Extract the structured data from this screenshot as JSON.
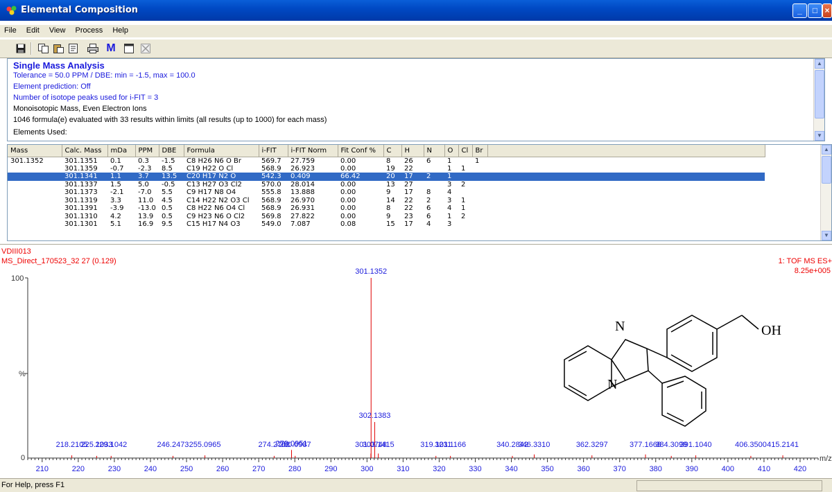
{
  "window": {
    "title": "Elemental Composition"
  },
  "menu": [
    {
      "label": "File",
      "key": "F"
    },
    {
      "label": "Edit",
      "key": "E"
    },
    {
      "label": "View",
      "key": "V"
    },
    {
      "label": "Process",
      "key": "P"
    },
    {
      "label": "Help",
      "key": "H"
    }
  ],
  "toolbar": [
    "save-icon",
    "copy-icon",
    "paste-icon",
    "properties-icon",
    "print-icon",
    "mass-icon",
    "window-icon",
    "delete-icon"
  ],
  "toolbar_mass_label": "M",
  "info": {
    "heading": "Single Mass Analysis",
    "tolerance": "Tolerance = 50.0 PPM   /   DBE: min = -1.5, max = 100.0",
    "element_prediction": "Element prediction: Off",
    "isotope_peaks": "Number of isotope peaks used for i-FIT = 3",
    "mass_mode": "Monoisotopic Mass, Even Electron Ions",
    "formulae": "1046 formula(e) evaluated with 33 results within limits (all results (up to 1000) for each mass)",
    "elements_used": "Elements Used:"
  },
  "results": {
    "columns": [
      "Mass",
      "Calc. Mass",
      "mDa",
      "PPM",
      "DBE",
      "Formula",
      "i-FIT",
      "i-FIT Norm",
      "Fit Conf %",
      "C",
      "H",
      "N",
      "O",
      "Cl",
      "Br"
    ],
    "rows": [
      [
        "301.1352",
        "301.1351",
        "0.1",
        "0.3",
        "-1.5",
        "C8  H26  N6  O  Br",
        "569.7",
        "27.759",
        "0.00",
        "8",
        "26",
        "6",
        "1",
        "",
        "1"
      ],
      [
        "",
        "301.1359",
        "-0.7",
        "-2.3",
        "8.5",
        "C19  H22  O  Cl",
        "568.9",
        "26.923",
        "0.00",
        "19",
        "22",
        "",
        "1",
        "1",
        ""
      ],
      [
        "",
        "301.1341",
        "1.1",
        "3.7",
        "13.5",
        "C20  H17  N2  O",
        "542.3",
        "0.409",
        "66.42",
        "20",
        "17",
        "2",
        "1",
        "",
        ""
      ],
      [
        "",
        "301.1337",
        "1.5",
        "5.0",
        "-0.5",
        "C13  H27  O3  Cl2",
        "570.0",
        "28.014",
        "0.00",
        "13",
        "27",
        "",
        "3",
        "2",
        ""
      ],
      [
        "",
        "301.1373",
        "-2.1",
        "-7.0",
        "5.5",
        "C9  H17  N8  O4",
        "555.8",
        "13.888",
        "0.00",
        "9",
        "17",
        "8",
        "4",
        "",
        ""
      ],
      [
        "",
        "301.1319",
        "3.3",
        "11.0",
        "4.5",
        "C14  H22  N2  O3  Cl",
        "568.9",
        "26.970",
        "0.00",
        "14",
        "22",
        "2",
        "3",
        "1",
        ""
      ],
      [
        "",
        "301.1391",
        "-3.9",
        "-13.0",
        "0.5",
        "C8  H22  N6  O4  Cl",
        "568.9",
        "26.931",
        "0.00",
        "8",
        "22",
        "6",
        "4",
        "1",
        ""
      ],
      [
        "",
        "301.1310",
        "4.2",
        "13.9",
        "0.5",
        "C9  H23  N6  O  Cl2",
        "569.8",
        "27.822",
        "0.00",
        "9",
        "23",
        "6",
        "1",
        "2",
        ""
      ],
      [
        "",
        "301.1301",
        "5.1",
        "16.9",
        "9.5",
        "C15  H17  N4  O3",
        "549.0",
        "7.087",
        "0.08",
        "15",
        "17",
        "4",
        "3",
        "",
        ""
      ]
    ],
    "selected_row": 2
  },
  "spectrum": {
    "sample": "VDIII013",
    "scan": "MS_Direct_170523_32 27 (0.129)",
    "mode": "1: TOF MS ES+",
    "intensity": "8.25e+005",
    "y_top": "100",
    "y_mid": "%",
    "y_zero": "0",
    "x_unit": "m/z",
    "molecule_label": "OH",
    "n_label": "N"
  },
  "chart_data": {
    "type": "bar",
    "xlim": [
      206,
      425
    ],
    "ylim": [
      0,
      100
    ],
    "xticks": [
      210,
      220,
      230,
      240,
      250,
      260,
      270,
      280,
      290,
      300,
      310,
      320,
      330,
      340,
      350,
      360,
      370,
      380,
      390,
      400,
      410,
      420
    ],
    "peaks": [
      {
        "mz": 218.2105,
        "rel": 1.5,
        "label": "218.2105"
      },
      {
        "mz": 225.1033,
        "rel": 1.2,
        "label": "225.1033"
      },
      {
        "mz": 229.1042,
        "rel": 1.2,
        "label": "229.1042"
      },
      {
        "mz": 246.2473,
        "rel": 1.2,
        "label": "246.2473"
      },
      {
        "mz": 255.0965,
        "rel": 1.5,
        "label": "255.0965"
      },
      {
        "mz": 274.2762,
        "rel": 1.2,
        "label": "274.2762"
      },
      {
        "mz": 279.0951,
        "rel": 4.5,
        "label": "279.0951"
      },
      {
        "mz": 280.0987,
        "rel": 1.2,
        "label": "280.0987"
      },
      {
        "mz": 301.0748,
        "rel": 2.5,
        "label": "301.0748"
      },
      {
        "mz": 301.1352,
        "rel": 100,
        "label": "301.1352"
      },
      {
        "mz": 302.1383,
        "rel": 20,
        "label": "302.1383"
      },
      {
        "mz": 303.1415,
        "rel": 2.5,
        "label": "303.1415"
      },
      {
        "mz": 319.1011,
        "rel": 1.2,
        "label": "319.1011"
      },
      {
        "mz": 323.1166,
        "rel": 1.2,
        "label": "323.1166"
      },
      {
        "mz": 340.2842,
        "rel": 1.2,
        "label": "340.2842"
      },
      {
        "mz": 346.331,
        "rel": 2,
        "label": "346.3310"
      },
      {
        "mz": 362.3297,
        "rel": 1.5,
        "label": "362.3297"
      },
      {
        "mz": 377.1668,
        "rel": 2,
        "label": "377.1668"
      },
      {
        "mz": 384.3099,
        "rel": 1.2,
        "label": "384.3099"
      },
      {
        "mz": 391.104,
        "rel": 1.5,
        "label": "391.1040"
      },
      {
        "mz": 406.35,
        "rel": 1.2,
        "label": "406.3500"
      },
      {
        "mz": 415.2141,
        "rel": 1.5,
        "label": "415.2141"
      }
    ]
  },
  "status": {
    "text": "For Help, press F1"
  },
  "colors": {
    "titlebar": "#0049c4",
    "selection": "#316ac5",
    "spectrum": "#e00000",
    "label": "#1a1adc"
  }
}
